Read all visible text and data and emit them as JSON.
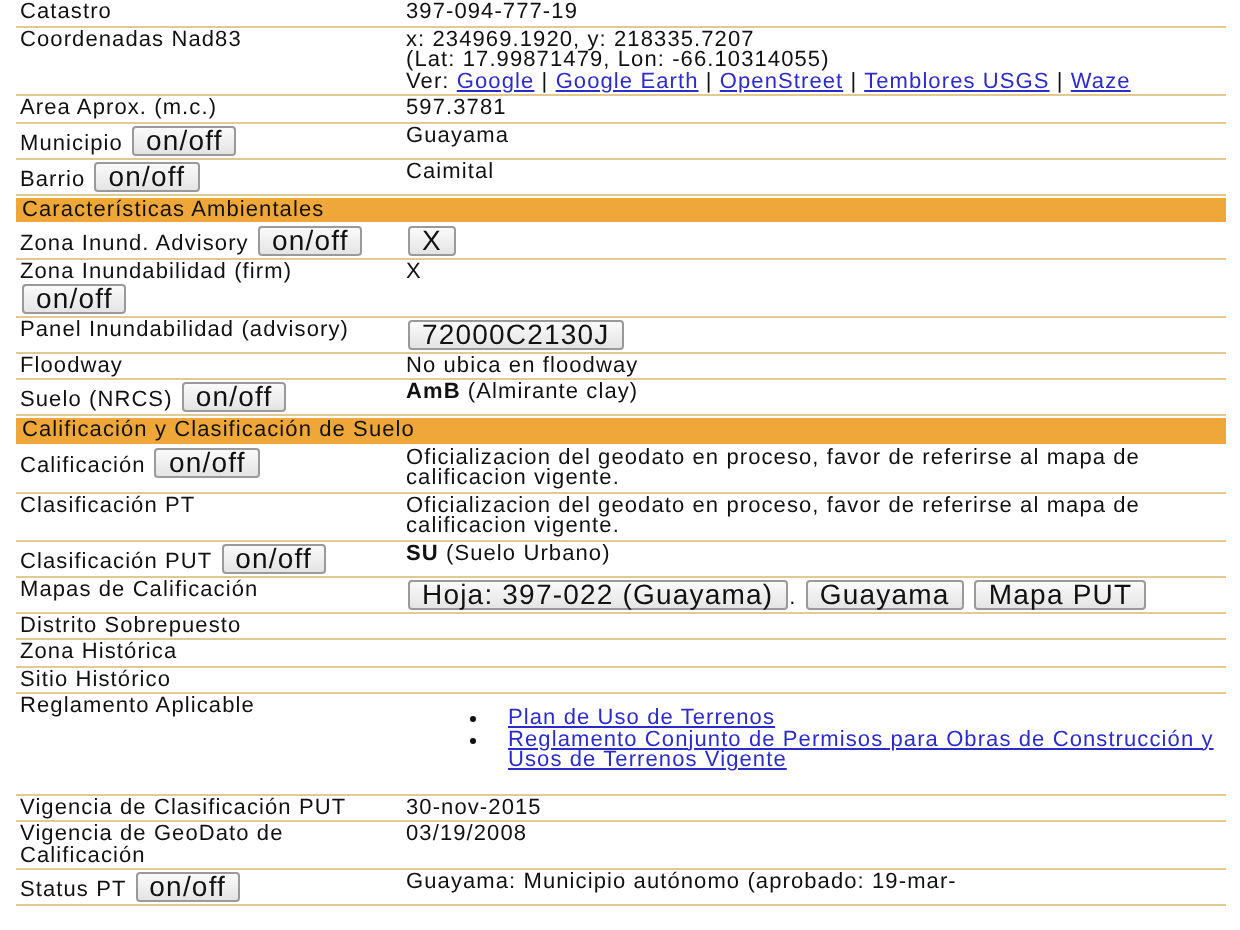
{
  "rows": [
    {
      "kind": "field",
      "label": "Catastro",
      "value": [
        {
          "kind": "text",
          "text": "397-094-777-19"
        }
      ]
    },
    {
      "kind": "field",
      "label": "Coordenadas Nad83",
      "value": [
        {
          "kind": "text",
          "text": "x: 234969.1920, y: 218335.7207"
        },
        {
          "kind": "break"
        },
        {
          "kind": "text",
          "text": "(Lat: 17.99871479, Lon: -66.10314055)"
        },
        {
          "kind": "break"
        },
        {
          "kind": "text",
          "text": "Ver:"
        },
        {
          "kind": "link",
          "text": "Google"
        },
        {
          "kind": "text",
          "text": "|"
        },
        {
          "kind": "link",
          "text": "Google Earth"
        },
        {
          "kind": "text",
          "text": "|"
        },
        {
          "kind": "link",
          "text": "OpenStreet"
        },
        {
          "kind": "text",
          "text": "|"
        },
        {
          "kind": "link",
          "text": "Temblores USGS"
        },
        {
          "kind": "text",
          "text": "|"
        },
        {
          "kind": "link",
          "text": "Waze"
        }
      ]
    },
    {
      "kind": "field",
      "label": "Area Aprox. (m.c.)",
      "value": [
        {
          "kind": "text",
          "text": "597.3781"
        }
      ]
    },
    {
      "kind": "field",
      "label": "Municipio",
      "toggle": "on/off",
      "value": [
        {
          "kind": "text",
          "text": "Guayama"
        }
      ]
    },
    {
      "kind": "field",
      "label": "Barrio",
      "toggle": "on/off",
      "value": [
        {
          "kind": "text",
          "text": "Caimital"
        }
      ]
    },
    {
      "kind": "section",
      "label": "Características Ambientales"
    },
    {
      "kind": "field",
      "label": "Zona Inund. Advisory",
      "toggle": "on/off",
      "value": [
        {
          "kind": "button",
          "text": "X"
        }
      ]
    },
    {
      "kind": "field",
      "label": "Zona Inundabilidad (firm)",
      "toggle": "on/off",
      "value": [
        {
          "kind": "text",
          "text": "X"
        }
      ]
    },
    {
      "kind": "field",
      "label": "Panel Inundabilidad (advisory)",
      "value": [
        {
          "kind": "button",
          "text": "72000C2130J"
        }
      ]
    },
    {
      "kind": "field",
      "label": "Floodway",
      "value": [
        {
          "kind": "text",
          "text": "No ubica en floodway"
        }
      ]
    },
    {
      "kind": "field",
      "label": "Suelo (NRCS)",
      "toggle": "on/off",
      "value": [
        {
          "kind": "text",
          "text": "**AmB** (Almirante clay)"
        }
      ]
    },
    {
      "kind": "section",
      "label": "Calificación y Clasificación de Suelo"
    },
    {
      "kind": "field",
      "label": "Calificación",
      "toggle": "on/off",
      "value": [
        {
          "kind": "text",
          "text": "Oficializacion del geodato en proceso, favor de referirse al mapa de calificacion vigente."
        }
      ]
    },
    {
      "kind": "field",
      "label": "Clasificación PT",
      "value": [
        {
          "kind": "text",
          "text": "Oficializacion del geodato en proceso, favor de referirse al mapa de calificacion vigente."
        }
      ]
    },
    {
      "kind": "field",
      "label": "Clasificación PUT",
      "toggle": "on/off",
      "value": [
        {
          "kind": "text",
          "text": "**SU** (Suelo Urbano)"
        }
      ]
    },
    {
      "kind": "field",
      "label": "Mapas de Calificación",
      "value": [
        {
          "kind": "button",
          "text": "Hoja: 397-022 (Guayama)"
        },
        {
          "kind": "text",
          "text": "."
        },
        {
          "kind": "button",
          "text": "Guayama"
        },
        {
          "kind": "button",
          "text": "Mapa PUT"
        }
      ]
    },
    {
      "kind": "field",
      "label": "Distrito Sobrepuesto",
      "value": []
    },
    {
      "kind": "field",
      "label": "Zona Histórica",
      "value": []
    },
    {
      "kind": "field",
      "label": "Sitio Histórico",
      "value": []
    },
    {
      "kind": "field",
      "label": "Reglamento Aplicable",
      "value": [
        {
          "kind": "bullets",
          "items": [
            "Plan de Uso de Terrenos",
            "Reglamento Conjunto de Permisos para Obras de Construcción y Usos de Terrenos Vigente"
          ]
        }
      ]
    },
    {
      "kind": "field",
      "label": "Vigencia de Clasificación PUT",
      "value": [
        {
          "kind": "text",
          "text": "30-nov-2015"
        }
      ]
    },
    {
      "kind": "field",
      "label": "Vigencia de GeoDato de Calificación",
      "value": [
        {
          "kind": "text",
          "text": "03/19/2008"
        }
      ]
    },
    {
      "kind": "field",
      "label": "Status PT",
      "toggle": "on/off",
      "value": [
        {
          "kind": "text",
          "text": "Guayama: Municipio autónomo (aprobado: 19-mar-"
        }
      ]
    }
  ]
}
